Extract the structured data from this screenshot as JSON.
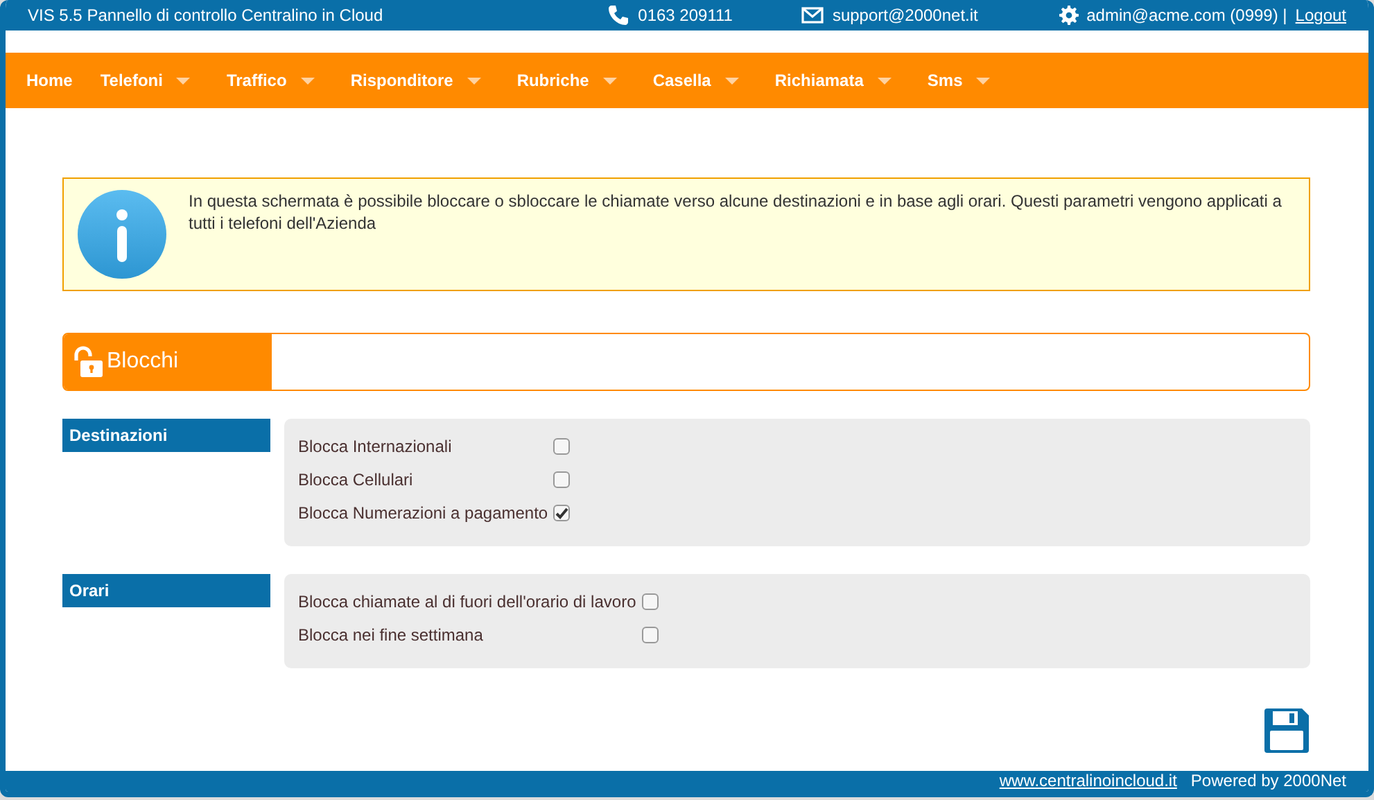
{
  "header": {
    "title": "VIS 5.5 Pannello di controllo Centralino in Cloud",
    "phone": "0163 209111",
    "email": "support@2000net.it",
    "user": "admin@acme.com (0999) |",
    "logout": "Logout"
  },
  "menu": [
    {
      "label": "Home",
      "dropdown": false
    },
    {
      "label": "Telefoni",
      "dropdown": true
    },
    {
      "label": "Traffico",
      "dropdown": true
    },
    {
      "label": "Risponditore",
      "dropdown": true
    },
    {
      "label": "Rubriche",
      "dropdown": true
    },
    {
      "label": "Casella",
      "dropdown": true
    },
    {
      "label": "Richiamata",
      "dropdown": true
    },
    {
      "label": "Sms",
      "dropdown": true
    }
  ],
  "info": "In questa schermata è possibile bloccare o sbloccare le chiamate verso alcune destinazioni e in base agli orari. Questi parametri vengono applicati a tutti i telefoni dell'Azienda",
  "panel": {
    "title": "Blocchi"
  },
  "sections": [
    {
      "title": "Destinazioni",
      "options": [
        {
          "label": "Blocca Internazionali",
          "checked": false
        },
        {
          "label": "Blocca Cellulari",
          "checked": false
        },
        {
          "label": "Blocca Numerazioni a pagamento",
          "checked": true
        }
      ]
    },
    {
      "title": "Orari",
      "options": [
        {
          "label": "Blocca chiamate al di fuori dell'orario di lavoro",
          "checked": false
        },
        {
          "label": "Blocca nei fine settimana",
          "checked": false
        }
      ]
    }
  ],
  "footer": {
    "link": "www.centralinoincloud.it",
    "powered": "Powered by 2000Net"
  }
}
